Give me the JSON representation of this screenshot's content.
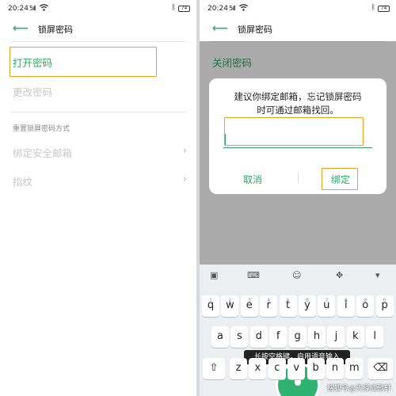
{
  "status": {
    "time": "20:24",
    "signal": "5ıll",
    "battery": "74"
  },
  "left": {
    "header": {
      "title": "锁屏密码"
    },
    "rows": {
      "open_password": "打开密码",
      "change_password": "更改密码",
      "section": "重置锁屏密码方式",
      "bind_email": "绑定安全邮箱",
      "fingerprint": "指纹"
    }
  },
  "right": {
    "header": {
      "title": "锁屏密码"
    },
    "row": {
      "close_password": "关闭密码"
    },
    "dialog": {
      "message_line1": "建议你绑定邮箱，忘记锁屏密码",
      "message_line2": "时可通过邮箱找回。",
      "email_value": "",
      "cancel": "取消",
      "bind": "绑定"
    },
    "keyboard": {
      "row1": [
        {
          "k": "q",
          "n": "1"
        },
        {
          "k": "w",
          "n": "2"
        },
        {
          "k": "e",
          "n": "3"
        },
        {
          "k": "r",
          "n": "4"
        },
        {
          "k": "t",
          "n": "5"
        },
        {
          "k": "y",
          "n": "6"
        },
        {
          "k": "u",
          "n": "7"
        },
        {
          "k": "i",
          "n": "8"
        },
        {
          "k": "o",
          "n": "9"
        },
        {
          "k": "p",
          "n": "0"
        }
      ],
      "row2": [
        "a",
        "s",
        "d",
        "f",
        "g",
        "h",
        "j",
        "k",
        "l"
      ],
      "row3": [
        "z",
        "x",
        "c",
        "v",
        "b",
        "n",
        "m"
      ],
      "tooltip": "长按空格键，启用语音输入"
    }
  },
  "watermark": "搜狐号@天择成歌轩",
  "colors": {
    "accent": "#2ca767",
    "highlight": "#f0a020"
  }
}
